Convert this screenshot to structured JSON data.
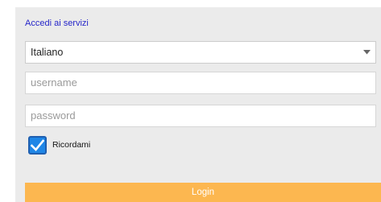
{
  "form": {
    "title": "Accedi ai servizi",
    "language": {
      "selected": "Italiano"
    },
    "username_placeholder": "username",
    "password_placeholder": "password",
    "remember": {
      "label": "Ricordami",
      "checked": true
    },
    "login_label": "Login"
  },
  "colors": {
    "panel_background": "#ebebeb",
    "title_link": "#2626c9",
    "checkbox_fill": "#1f86e6",
    "login_button": "#fcb750",
    "login_text": "#ffffff"
  },
  "icons": {
    "dropdown": "chevron-down-icon",
    "checkbox": "checkmark-icon"
  }
}
